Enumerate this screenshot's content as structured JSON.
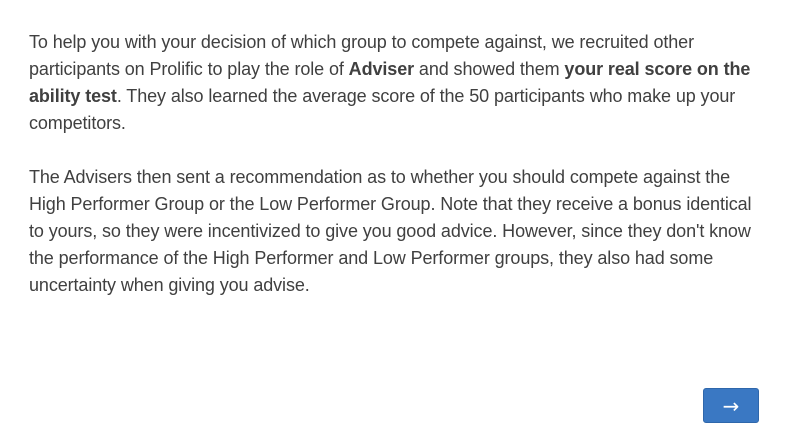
{
  "paragraph1": {
    "part1": "To help you with your decision of which group to compete against, we recruited other participants on Prolific to play the role of ",
    "bold1": "Adviser",
    "part2": " and showed them ",
    "bold2": "your real score on the ability test",
    "part3": ". They also learned the average score of the 50 participants who make up your competitors."
  },
  "paragraph2": {
    "text": "The Advisers then sent a recommendation as to whether you should compete against the High Performer Group or the Low Performer Group. Note that they receive a bonus identical to yours, so they were incentivized to give you good advice. However, since they don't know the performance of the High Performer and Low Performer groups, they also had some uncertainty when giving you advise."
  },
  "next_button": {
    "label": "→",
    "icon": "right-arrow-icon",
    "color": "#3a78c3"
  }
}
